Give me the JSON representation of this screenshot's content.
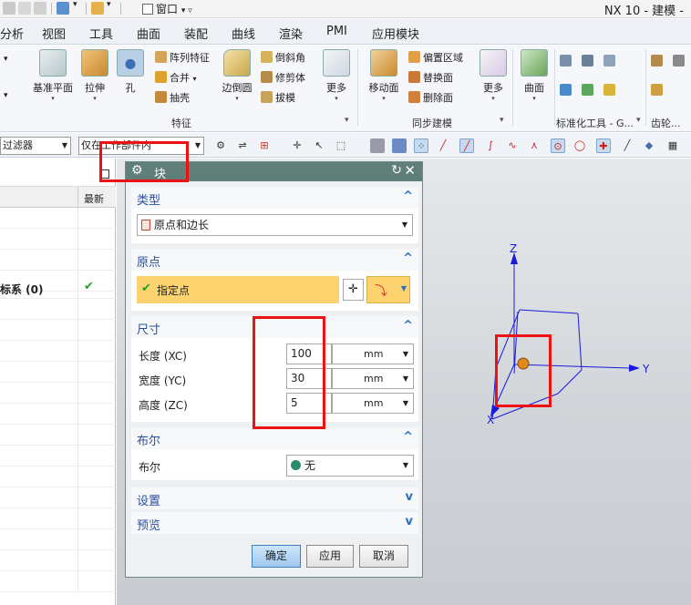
{
  "title_bar": {
    "window_menu": "窗口",
    "app_title": "NX 10 - 建模 -"
  },
  "menu": [
    "分析",
    "视图",
    "工具",
    "曲面",
    "装配",
    "曲线",
    "渲染",
    "PMI",
    "应用模块"
  ],
  "ribbon": {
    "datum_plane": "基准平面",
    "extrude": "拉伸",
    "hole": "孔",
    "pattern_feature": "阵列特征",
    "unite": "合并",
    "shell": "抽壳",
    "edge_blend": "边倒圆",
    "chamfer": "倒斜角",
    "trim_body": "修剪体",
    "draft": "拔模",
    "more1": "更多",
    "group_feature": "特征",
    "move_face": "移动面",
    "offset_region": "偏置区域",
    "replace_face": "替换面",
    "delete_face": "删除面",
    "more2": "更多",
    "group_sync": "同步建模",
    "surface": "曲面",
    "group_standard": "标准化工具 - G...",
    "group_gear": "齿轮..."
  },
  "filter_bar": {
    "type_filter": "过滤器",
    "scope_filter": "仅在工作部件内"
  },
  "navigator": {
    "col_latest": "最新",
    "row_name": "标系 (0)",
    "row_check": "✔"
  },
  "dialog": {
    "title": "块",
    "type_section": "类型",
    "type_value": "原点和边长",
    "origin_section": "原点",
    "specify_point": "指定点",
    "dimensions_section": "尺寸",
    "length_label": "长度 (XC)",
    "length_value": "100",
    "width_label": "宽度 (YC)",
    "width_value": "30",
    "height_label": "高度 (ZC)",
    "height_value": "5",
    "unit": "mm",
    "boolean_section": "布尔",
    "boolean_label": "布尔",
    "boolean_value": "无",
    "settings_section": "设置",
    "preview_section": "预览",
    "ok": "确定",
    "apply": "应用",
    "cancel": "取消"
  },
  "axes": {
    "x": "X",
    "y": "Y",
    "z": "Z"
  },
  "colors": {
    "dialog_title": "#5f7f78",
    "highlight_field": "#fcd36f",
    "axis_blue": "#1a1adc",
    "annotation_red": "#e11111",
    "origin_point": "#e08a1e"
  }
}
